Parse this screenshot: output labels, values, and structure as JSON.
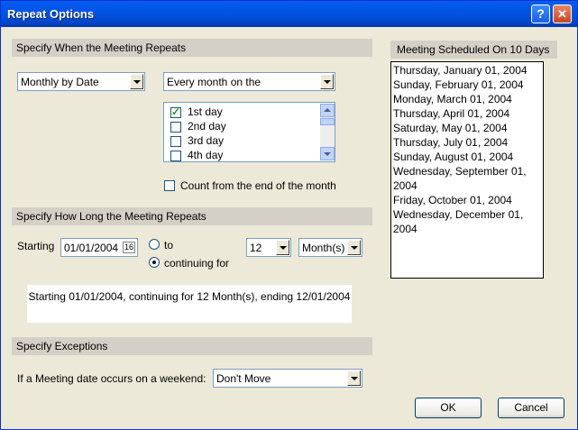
{
  "window": {
    "title": "Repeat Options",
    "help": "?",
    "close": "✕"
  },
  "when": {
    "section_title": "Specify When the Meeting Repeats",
    "repeat_type": "Monthly by Date",
    "frequency": "Every month on the",
    "days": [
      {
        "label": "1st day",
        "checked": true
      },
      {
        "label": "2nd day",
        "checked": false
      },
      {
        "label": "3rd day",
        "checked": false
      },
      {
        "label": "4th day",
        "checked": false
      }
    ],
    "count_from_end_label": "Count from the end of the month"
  },
  "howlong": {
    "section_title": "Specify How Long the Meeting Repeats",
    "starting_label": "Starting",
    "starting_value": "01/01/2004",
    "calendar_icon_text": "16",
    "to_label": "to",
    "continuing_label": "continuing for",
    "count_value": "12",
    "unit_value": "Month(s)",
    "summary": "Starting 01/01/2004, continuing for 12 Month(s), ending 12/01/2004"
  },
  "exceptions": {
    "section_title": "Specify Exceptions",
    "weekend_label": "If a Meeting date occurs on a weekend:",
    "weekend_value": "Don't Move"
  },
  "scheduled": {
    "title": "Meeting Scheduled On 10 Days",
    "dates": [
      "Thursday, January 01, 2004",
      "Sunday, February 01, 2004",
      "Monday, March 01, 2004",
      "Thursday, April 01, 2004",
      "Saturday, May 01, 2004",
      "Thursday, July 01, 2004",
      "Sunday, August 01, 2004",
      "Wednesday, September 01, 2004",
      "Friday, October 01, 2004",
      "Wednesday, December 01, 2004"
    ]
  },
  "buttons": {
    "ok": "OK",
    "cancel": "Cancel"
  }
}
